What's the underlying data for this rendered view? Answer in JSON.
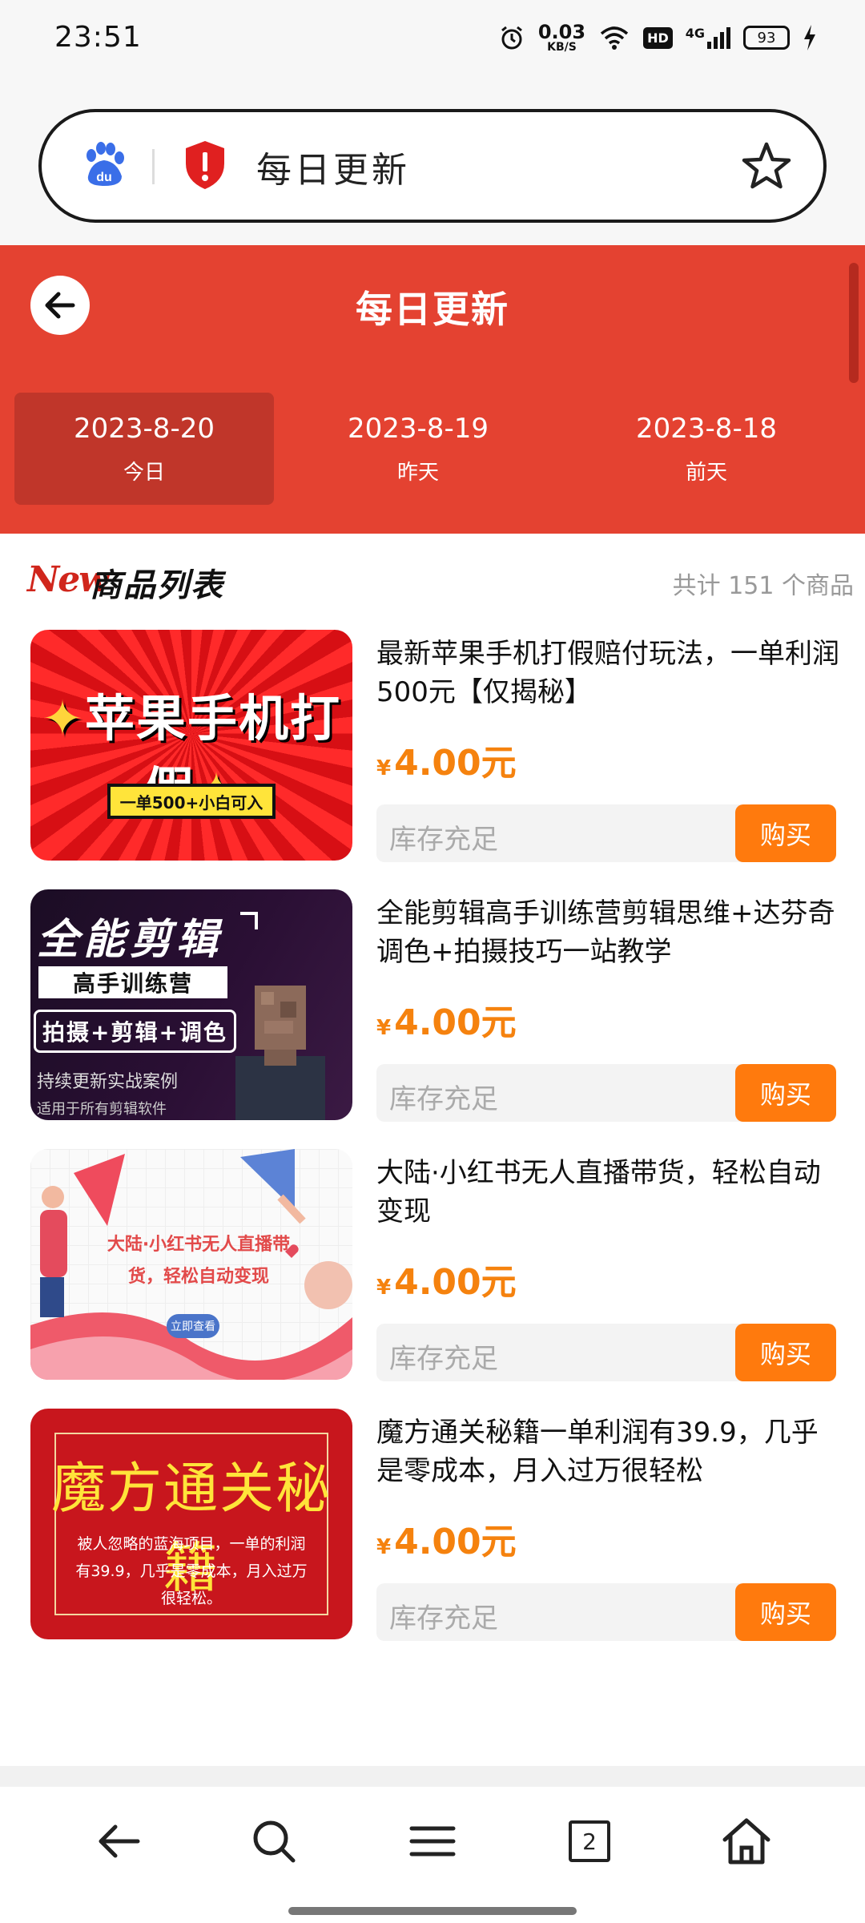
{
  "status_bar": {
    "time": "23:51",
    "net_speed_value": "0.03",
    "net_speed_unit": "KB/S",
    "hd_label": "HD",
    "network_label": "4G",
    "battery": "93",
    "icons": [
      "alarm-icon",
      "wifi-icon",
      "signal-icon",
      "charging-icon"
    ]
  },
  "browser": {
    "url_text": "每日更新",
    "icons": [
      "baidu-paw-icon",
      "shield-alert-icon",
      "star-icon"
    ]
  },
  "header": {
    "title": "每日更新",
    "accent_color": "#e44231",
    "date_tabs": [
      {
        "date": "2023-8-20",
        "label": "今日",
        "active": true
      },
      {
        "date": "2023-8-19",
        "label": "昨天",
        "active": false
      },
      {
        "date": "2023-8-18",
        "label": "前天",
        "active": false
      }
    ]
  },
  "list": {
    "logo": "New",
    "title": "商品列表",
    "count": "共计 151 个商品"
  },
  "products": [
    {
      "title": "最新苹果手机打假赔付玩法，一单利润500元【仅揭秘】",
      "currency": "¥",
      "price": "4.00元",
      "stock": "库存充足",
      "buy": "购买",
      "thumb_title": "苹果手机打假",
      "thumb_spark": "✦",
      "thumb_tag": "一单500+小白可入"
    },
    {
      "title": "全能剪辑高手训练营剪辑思维+达芬奇调色+拍摄技巧一站教学",
      "currency": "¥",
      "price": "4.00元",
      "stock": "库存充足",
      "buy": "购买",
      "thumb_line1": "全能剪辑",
      "thumb_line2": "高手训练营",
      "thumb_line3": "拍摄+剪辑+调色",
      "thumb_line4": "持续更新实战案例",
      "thumb_line5": "适用于所有剪辑软件"
    },
    {
      "title": "大陆·小红书无人直播带货，轻松自动变现",
      "currency": "¥",
      "price": "4.00元",
      "stock": "库存充足",
      "buy": "购买",
      "thumb_text": "大陆·小红书无人直播带货，轻松自动变现",
      "thumb_btn": "立即查看"
    },
    {
      "title": "魔方通关秘籍一单利润有39.9，几乎是零成本，月入过万很轻松",
      "currency": "¥",
      "price": "4.00元",
      "stock": "库存充足",
      "buy": "购买",
      "thumb_title": "魔方通关秘籍",
      "thumb_text": "被人忽略的蓝海项目，一单的利润有39.9，几乎是零成本，月入过万很轻松。"
    }
  ],
  "bottom_nav": {
    "tab_count": "2",
    "icons": [
      "back-arrow-icon",
      "search-icon",
      "menu-icon",
      "tabs-icon",
      "home-icon"
    ]
  }
}
